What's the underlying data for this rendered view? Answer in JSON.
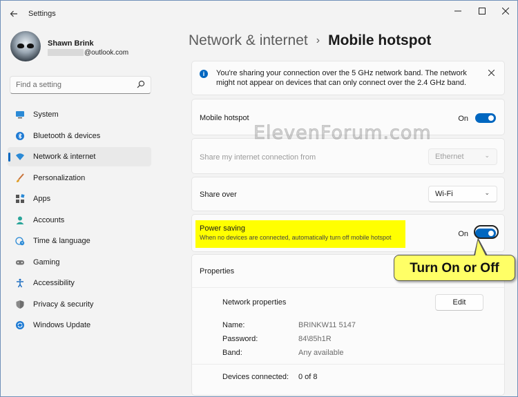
{
  "window": {
    "title": "Settings",
    "back_icon": "arrow-left-icon",
    "controls": [
      "minimize-icon",
      "maximize-icon",
      "close-icon"
    ]
  },
  "profile": {
    "name": "Shawn Brink",
    "email": "@outlook.com"
  },
  "search": {
    "placeholder": "Find a setting",
    "icon": "search-icon"
  },
  "sidebar": {
    "items": [
      {
        "label": "System",
        "icon": "system-icon",
        "active": false
      },
      {
        "label": "Bluetooth & devices",
        "icon": "bluetooth-icon",
        "active": false
      },
      {
        "label": "Network & internet",
        "icon": "wifi-icon",
        "active": true
      },
      {
        "label": "Personalization",
        "icon": "brush-icon",
        "active": false
      },
      {
        "label": "Apps",
        "icon": "apps-icon",
        "active": false
      },
      {
        "label": "Accounts",
        "icon": "person-icon",
        "active": false
      },
      {
        "label": "Time & language",
        "icon": "globe-clock-icon",
        "active": false
      },
      {
        "label": "Gaming",
        "icon": "gamepad-icon",
        "active": false
      },
      {
        "label": "Accessibility",
        "icon": "accessibility-icon",
        "active": false
      },
      {
        "label": "Privacy & security",
        "icon": "shield-icon",
        "active": false
      },
      {
        "label": "Windows Update",
        "icon": "update-icon",
        "active": false
      }
    ]
  },
  "breadcrumb": {
    "parent": "Network & internet",
    "separator": "›",
    "current": "Mobile hotspot"
  },
  "info_banner": {
    "icon": "info-icon",
    "text": "You're sharing your connection over the 5 GHz network band. The network might not appear on devices that can only connect over the 2.4 GHz band.",
    "close_icon": "close-icon"
  },
  "mobile_hotspot": {
    "label": "Mobile hotspot",
    "state_text": "On",
    "on": true
  },
  "share_from": {
    "label": "Share my internet connection from",
    "value": "Ethernet",
    "enabled": false
  },
  "share_over": {
    "label": "Share over",
    "value": "Wi-Fi"
  },
  "power_saving": {
    "label": "Power saving",
    "description": "When no devices are connected, automatically turn off mobile hotspot",
    "state_text": "On",
    "on": true
  },
  "callout": {
    "text": "Turn On or Off"
  },
  "properties": {
    "header": "Properties",
    "network_properties_label": "Network properties",
    "edit_label": "Edit",
    "name_label": "Name:",
    "name_value": "BRINKW11 5147",
    "password_label": "Password:",
    "password_value": "84\\85h1R",
    "band_label": "Band:",
    "band_value": "Any available",
    "devices_label": "Devices connected:",
    "devices_value": "0 of 8"
  },
  "watermark": "ElevenForum.com",
  "colors": {
    "accent": "#0067c0",
    "highlight": "#ffff00",
    "callout": "#ffff66",
    "background": "#f3f3f3"
  }
}
